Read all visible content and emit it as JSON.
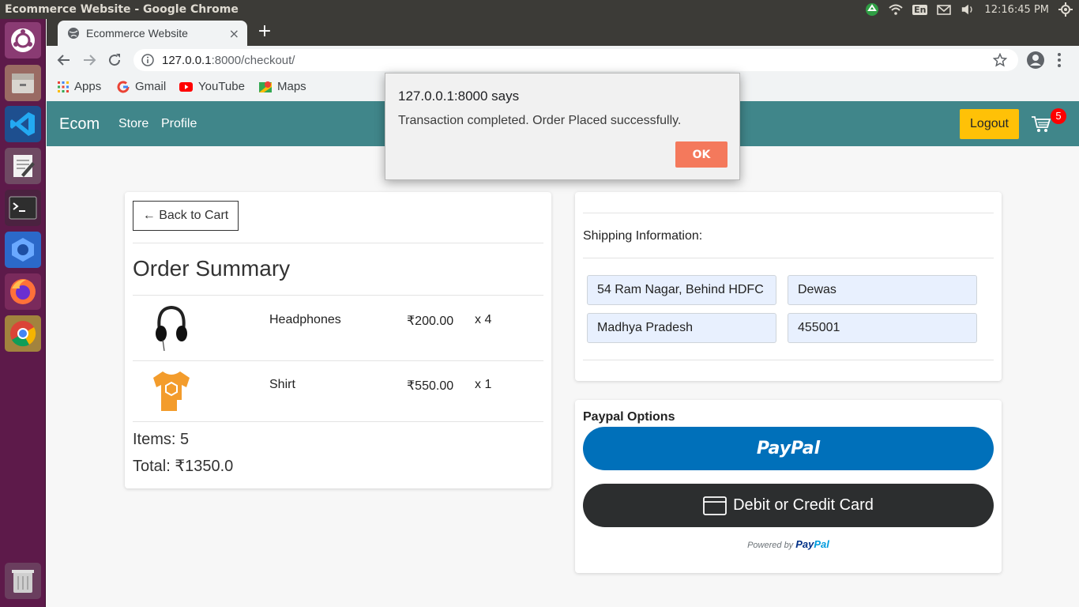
{
  "os": {
    "window_title": "Ecommerce Website - Google Chrome",
    "clock": "12:16:45 PM",
    "keyboard_layout": "En",
    "launcher_apps": [
      "ubuntu-dash-icon",
      "files-icon",
      "vscode-icon",
      "text-editor-icon",
      "terminal-icon",
      "screenshot-icon",
      "firefox-icon",
      "chrome-icon",
      "trash-icon"
    ]
  },
  "browser": {
    "tab_title": "Ecommerce Website",
    "new_tab": "+",
    "tab_close": "×",
    "url_host": "127.0.0.1",
    "url_path": ":8000/checkout/",
    "bookmarks": [
      "Apps",
      "Gmail",
      "YouTube",
      "Maps"
    ]
  },
  "navbar": {
    "brand": "Ecom",
    "links": [
      "Store",
      "Profile"
    ],
    "logout_label": "Logout",
    "cart_count": "5"
  },
  "cart": {
    "back_label": "← Back to Cart",
    "title": "Order Summary",
    "items": [
      {
        "name": "Headphones",
        "price": "₹200.00",
        "qty": "x 4"
      },
      {
        "name": "Shirt",
        "price": "₹550.00",
        "qty": "x 1"
      }
    ],
    "items_total": "Items: 5",
    "total": "Total: ₹1350.0"
  },
  "shipping": {
    "label": "Shipping Information:",
    "address": "54 Ram Nagar, Behind HDFC",
    "city": "Dewas",
    "state": "Madhya Pradesh",
    "zipcode": "455001"
  },
  "payment": {
    "label": "Paypal Options",
    "paypal_label": "PayPal",
    "card_label": "Debit or Credit Card",
    "powered_by": "Powered by",
    "powered_brand_a": "Pay",
    "powered_brand_b": "Pal"
  },
  "dialog": {
    "title": "127.0.0.1:8000 says",
    "message": "Transaction completed. Order Placed successfully.",
    "ok_label": "OK"
  },
  "colors": {
    "navbar": "#40868a",
    "logout": "#ffc107",
    "paypal": "#0070ba",
    "card_button": "#2c2e2f",
    "ok_button": "#f4795c",
    "launcher": "#5d1a4a"
  }
}
